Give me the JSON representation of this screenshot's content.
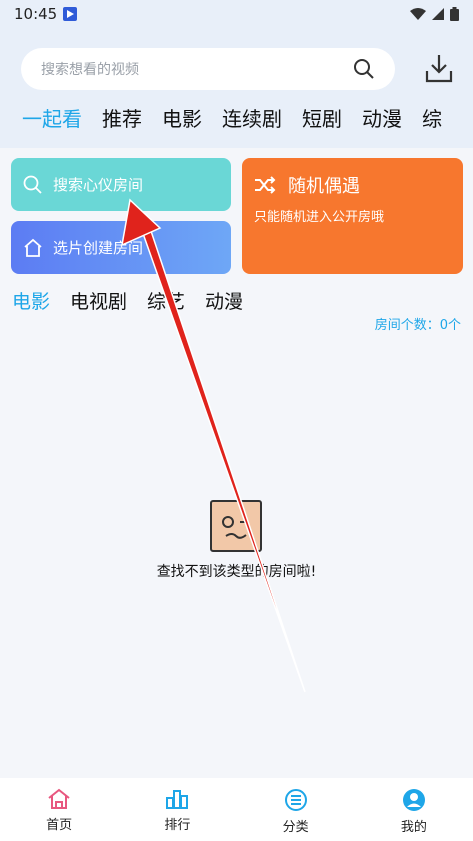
{
  "status": {
    "time": "10:45"
  },
  "search": {
    "placeholder": "搜索想看的视频"
  },
  "tabs": [
    "一起看",
    "推荐",
    "电影",
    "连续剧",
    "短剧",
    "动漫",
    "综"
  ],
  "cards": {
    "search_room": "搜索心仪房间",
    "create_room": "选片创建房间",
    "random_title": "随机偶遇",
    "random_sub": "只能随机进入公开房哦"
  },
  "category_tabs": [
    "电影",
    "电视剧",
    "综艺",
    "动漫"
  ],
  "room_count": "房间个数：0个",
  "empty_text": "查找不到该类型的房间啦!",
  "nav": [
    "首页",
    "排行",
    "分类",
    "我的"
  ],
  "colors": {
    "accent": "#1ea6e8",
    "teal": "#6ad7d6",
    "orange": "#f7772e",
    "blue": "#5c7cf3",
    "arrow": "#e0231c"
  }
}
